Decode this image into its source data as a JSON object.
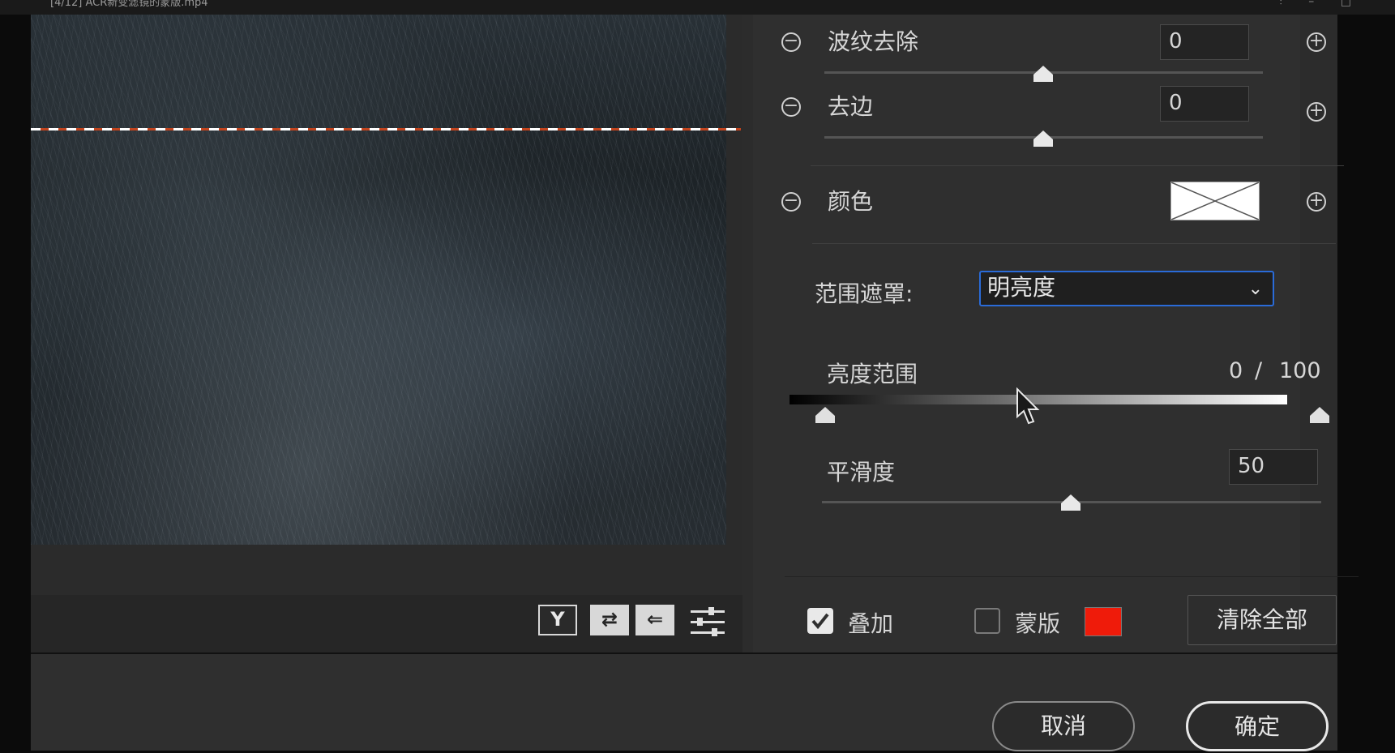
{
  "window": {
    "title": "[4/12] ACR新变滤镜的蒙版.mp4"
  },
  "preview": {
    "tools": [
      {
        "name": "y-tool",
        "label": "Y"
      },
      {
        "name": "swap-tool",
        "label": "⇄"
      },
      {
        "name": "copy-tool",
        "label": "⇐"
      }
    ]
  },
  "panel": {
    "moire": {
      "label": "波纹去除",
      "value": "0",
      "slider": 0.5
    },
    "defringe": {
      "label": "去边",
      "value": "0",
      "slider": 0.5
    },
    "color": {
      "label": "颜色"
    },
    "range_mask": {
      "label": "范围遮罩:",
      "selected": "明亮度"
    },
    "luminance_range": {
      "label": "亮度范围",
      "low": "0",
      "separator": "/",
      "high": "100"
    },
    "smoothness": {
      "label": "平滑度",
      "value": "50",
      "slider": 0.5
    },
    "overlay": {
      "label": "叠加",
      "checked": true
    },
    "mask": {
      "label": "蒙版",
      "checked": false,
      "color": "#ef1b0a"
    },
    "clear_all": "清除全部"
  },
  "buttons": {
    "cancel": "取消",
    "ok": "确定"
  },
  "icons": {
    "minus": "minus-circle-icon",
    "plus": "plus-circle-icon",
    "chevron": "chevron-down-icon"
  }
}
